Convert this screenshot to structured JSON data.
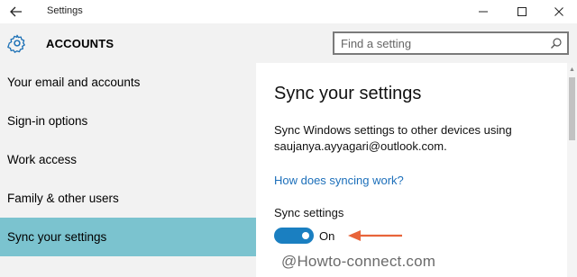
{
  "window": {
    "title": "Settings",
    "back_icon": "arrow-left-icon",
    "minimize_icon": "minimize-icon",
    "maximize_icon": "maximize-icon",
    "close_icon": "close-icon"
  },
  "header": {
    "icon": "gear-icon",
    "title": "ACCOUNTS",
    "search": {
      "placeholder": "Find a setting",
      "icon": "search-icon"
    }
  },
  "sidebar": {
    "items": [
      {
        "label": "Your email and accounts",
        "active": false
      },
      {
        "label": "Sign-in options",
        "active": false
      },
      {
        "label": "Work access",
        "active": false
      },
      {
        "label": "Family & other users",
        "active": false
      },
      {
        "label": "Sync your settings",
        "active": true
      }
    ],
    "active_color": "#7bc3cf"
  },
  "main": {
    "title": "Sync your settings",
    "description": "Sync Windows settings to other devices using saujanya.ayyagari@outlook.com.",
    "link": "How does syncing work?",
    "sync_label": "Sync settings",
    "toggle": {
      "state": "On",
      "on": true,
      "color": "#1a7fc1"
    },
    "annotation_arrow_color": "#e8643a",
    "watermark": "@Howto-connect.com"
  }
}
